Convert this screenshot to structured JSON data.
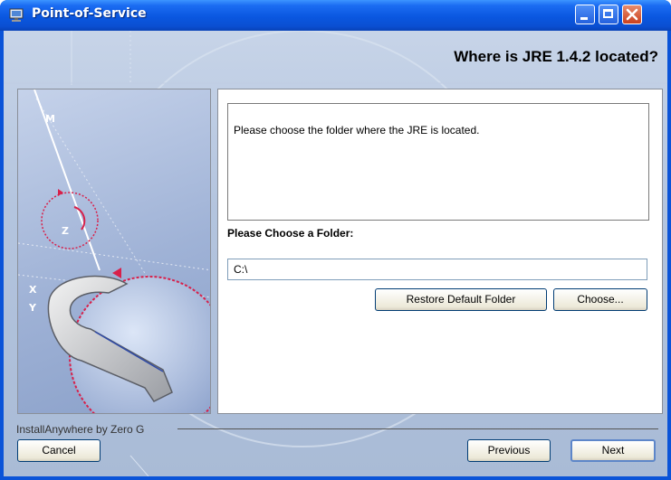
{
  "window": {
    "title": "Point-of-Service",
    "accent": "#0a53d8"
  },
  "header": {
    "heading": "Where is JRE 1.4.2 located?"
  },
  "main": {
    "message": "Please choose the folder where the JRE is located.",
    "choose_label": "Please Choose a Folder:",
    "folder_value": "C:\\",
    "restore_button": "Restore Default Folder",
    "choose_button": "Choose..."
  },
  "footer": {
    "vendor_text": "InstallAnywhere by Zero G",
    "cancel_button": "Cancel",
    "previous_button": "Previous",
    "next_button": "Next"
  },
  "side_art": {
    "axis_labels": [
      "M",
      "Z",
      "X",
      "Y"
    ],
    "icon": "wrench-icon"
  }
}
